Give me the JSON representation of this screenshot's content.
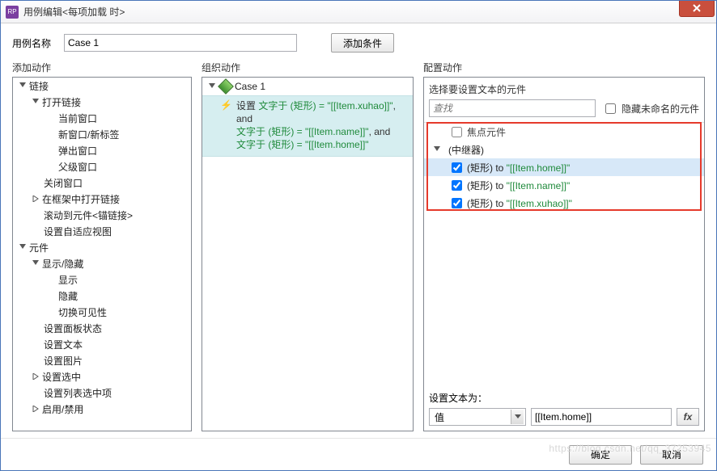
{
  "window": {
    "title": "用例编辑<每项加载 时>"
  },
  "nameRow": {
    "label": "用例名称",
    "value": "Case 1",
    "addCondBtn": "添加条件"
  },
  "headers": {
    "left": "添加动作",
    "mid": "组织动作",
    "right": "配置动作"
  },
  "leftTree": {
    "n0": "链接",
    "n0_0": "打开链接",
    "n0_0_0": "当前窗口",
    "n0_0_1": "新窗口/新标签",
    "n0_0_2": "弹出窗口",
    "n0_0_3": "父级窗口",
    "n0_1": "关闭窗口",
    "n0_2": "在框架中打开链接",
    "n0_3": "滚动到元件<锚链接>",
    "n0_4": "设置自适应视图",
    "n1": "元件",
    "n1_0": "显示/隐藏",
    "n1_0_0": "显示",
    "n1_0_1": "隐藏",
    "n1_0_2": "切换可见性",
    "n1_1": "设置面板状态",
    "n1_2": "设置文本",
    "n1_3": "设置图片",
    "n1_4": "设置选中",
    "n1_5": "设置列表选中项",
    "n1_6": "启用/禁用"
  },
  "mid": {
    "caseName": "Case 1",
    "a_pre": "设置 ",
    "a_l1a": "文字于 (矩形) = \"[[Item.xuhao]]\"",
    "a_l1b": ", and",
    "a_l2a": "文字于 (矩形) = \"[[Item.name]]\"",
    "a_l2b": ", and",
    "a_l3": "文字于 (矩形) = \"[[Item.home]]\""
  },
  "right": {
    "selectLabel": "选择要设置文本的元件",
    "searchPH": "查找",
    "hideUnnamed": "隐藏未命名的元件",
    "focusComp": "焦点元件",
    "repeater": "(中继器)",
    "shape": "(矩形) ",
    "to": "to ",
    "v1": "\"[[Item.home]]\"",
    "v2": "\"[[Item.name]]\"",
    "v3": "\"[[Item.xuhao]]\"",
    "setLabel": "设置文本为：",
    "comboVal": "值",
    "textVal": "[[Item.home]]",
    "fx": "fx"
  },
  "footer": {
    "ok": "确定",
    "cancel": "取消"
  },
  "watermark": "https://blog.csdn.net/qq_37253945"
}
